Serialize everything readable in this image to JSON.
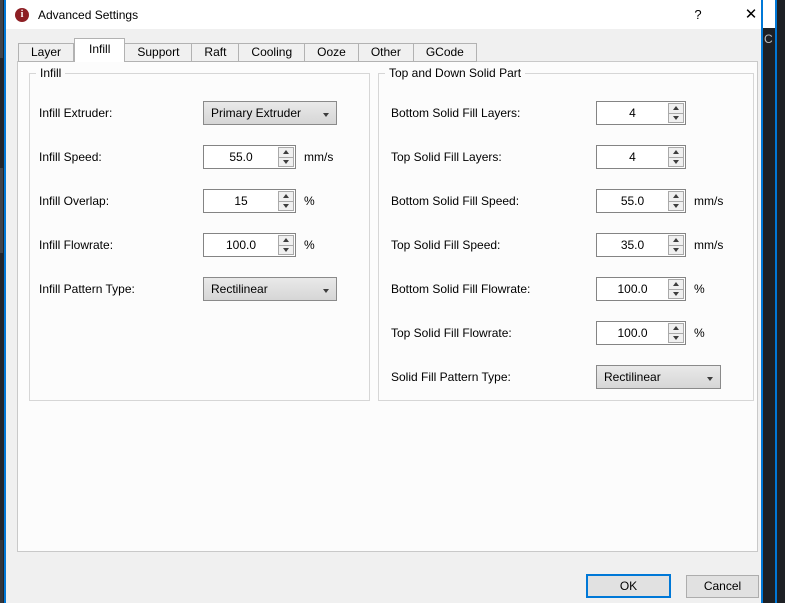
{
  "window": {
    "title": "Advanced Settings",
    "icon_label": "i",
    "help_label": "?",
    "close_label": "✕"
  },
  "tabs": [
    {
      "label": "Layer",
      "selected": false
    },
    {
      "label": "Infill",
      "selected": true
    },
    {
      "label": "Support",
      "selected": false
    },
    {
      "label": "Raft",
      "selected": false
    },
    {
      "label": "Cooling",
      "selected": false
    },
    {
      "label": "Ooze",
      "selected": false
    },
    {
      "label": "Other",
      "selected": false
    },
    {
      "label": "GCode",
      "selected": false
    }
  ],
  "infill_group": {
    "title": "Infill",
    "rows": [
      {
        "label": "Infill Extruder:",
        "control": "dropdown",
        "value": "Primary Extruder",
        "unit": ""
      },
      {
        "label": "Infill Speed:",
        "control": "spinbox",
        "value": "55.0",
        "unit": "mm/s"
      },
      {
        "label": "Infill Overlap:",
        "control": "spinbox",
        "value": "15",
        "unit": "%"
      },
      {
        "label": "Infill Flowrate:",
        "control": "spinbox",
        "value": "100.0",
        "unit": "%"
      },
      {
        "label": "Infill Pattern Type:",
        "control": "dropdown",
        "value": "Rectilinear",
        "unit": ""
      }
    ]
  },
  "solid_group": {
    "title": "Top and Down Solid Part",
    "rows": [
      {
        "label": "Bottom Solid Fill Layers:",
        "control": "spinbox",
        "value": "4",
        "unit": ""
      },
      {
        "label": "Top Solid Fill Layers:",
        "control": "spinbox",
        "value": "4",
        "unit": ""
      },
      {
        "label": "Bottom Solid Fill Speed:",
        "control": "spinbox",
        "value": "55.0",
        "unit": "mm/s"
      },
      {
        "label": "Top Solid Fill Speed:",
        "control": "spinbox",
        "value": "35.0",
        "unit": "mm/s"
      },
      {
        "label": "Bottom Solid Fill Flowrate:",
        "control": "spinbox",
        "value": "100.0",
        "unit": "%"
      },
      {
        "label": "Top Solid Fill Flowrate:",
        "control": "spinbox",
        "value": "100.0",
        "unit": "%"
      },
      {
        "label": "Solid Fill Pattern Type:",
        "control": "dropdown",
        "value": "Rectilinear",
        "unit": ""
      }
    ]
  },
  "footer": {
    "ok_label": "OK",
    "cancel_label": "Cancel"
  },
  "background_app": {
    "partial_text": "C"
  },
  "colors": {
    "accent_blue": "#0078d7",
    "icon_red": "#8d1f24",
    "titlebar_bg": "#ffffff",
    "dialog_bg": "#f0f0f0",
    "pane_bg": "#fcfcfc",
    "background_dark": "#23262b"
  }
}
